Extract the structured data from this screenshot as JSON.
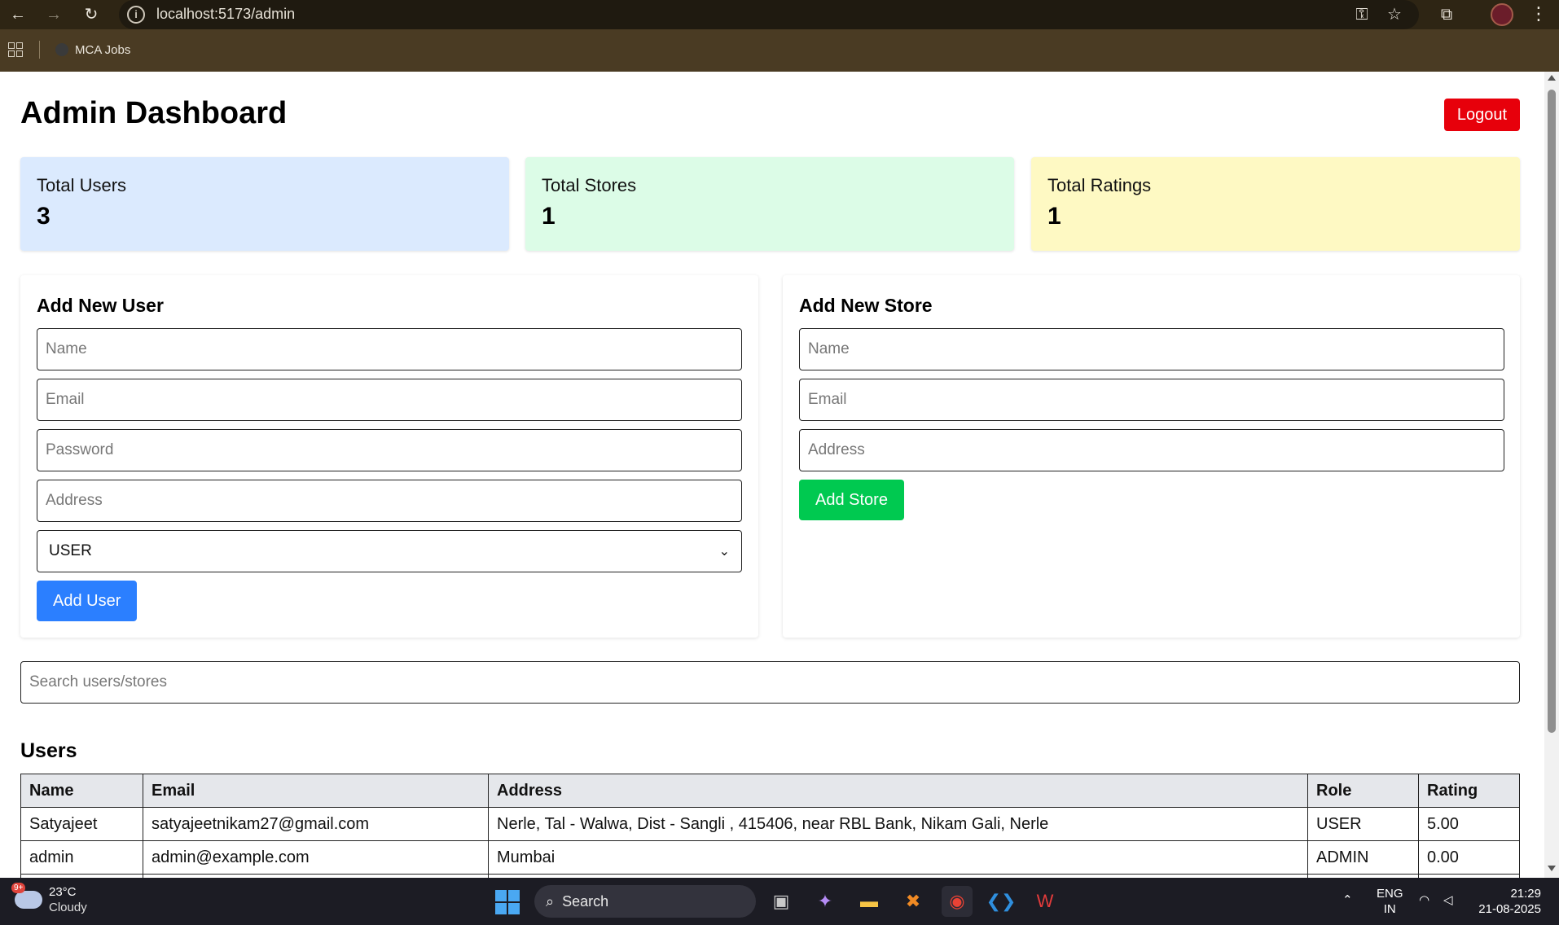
{
  "browser": {
    "url": "localhost:5173/admin",
    "bookmark": "MCA Jobs"
  },
  "header": {
    "title": "Admin Dashboard",
    "logout_label": "Logout"
  },
  "stats": [
    {
      "label": "Total Users",
      "value": "3",
      "color": "#dbeafe"
    },
    {
      "label": "Total Stores",
      "value": "1",
      "color": "#dcfce7"
    },
    {
      "label": "Total Ratings",
      "value": "1",
      "color": "#fef9c3"
    }
  ],
  "add_user": {
    "title": "Add New User",
    "name_placeholder": "Name",
    "email_placeholder": "Email",
    "password_placeholder": "Password",
    "address_placeholder": "Address",
    "role_selected": "USER",
    "button": "Add User",
    "button_color": "#2b7fff"
  },
  "add_store": {
    "title": "Add New Store",
    "name_placeholder": "Name",
    "email_placeholder": "Email",
    "address_placeholder": "Address",
    "button": "Add Store",
    "button_color": "#00c950"
  },
  "search": {
    "placeholder": "Search users/stores"
  },
  "users": {
    "title": "Users",
    "columns": [
      "Name",
      "Email",
      "Address",
      "Role",
      "Rating"
    ],
    "rows": [
      [
        "Satyajeet",
        "satyajeetnikam27@gmail.com",
        "Nerle, Tal - Walwa, Dist - Sangli , 415406, near RBL Bank, Nikam Gali, Nerle",
        "USER",
        "5.00"
      ],
      [
        "admin",
        "admin@example.com",
        "Mumbai",
        "ADMIN",
        "0.00"
      ]
    ]
  },
  "taskbar": {
    "temperature": "23°C",
    "condition": "Cloudy",
    "badge": "9+",
    "search_label": "Search",
    "lang_top": "ENG",
    "lang_bottom": "IN",
    "time": "21:29",
    "date": "21-08-2025"
  }
}
